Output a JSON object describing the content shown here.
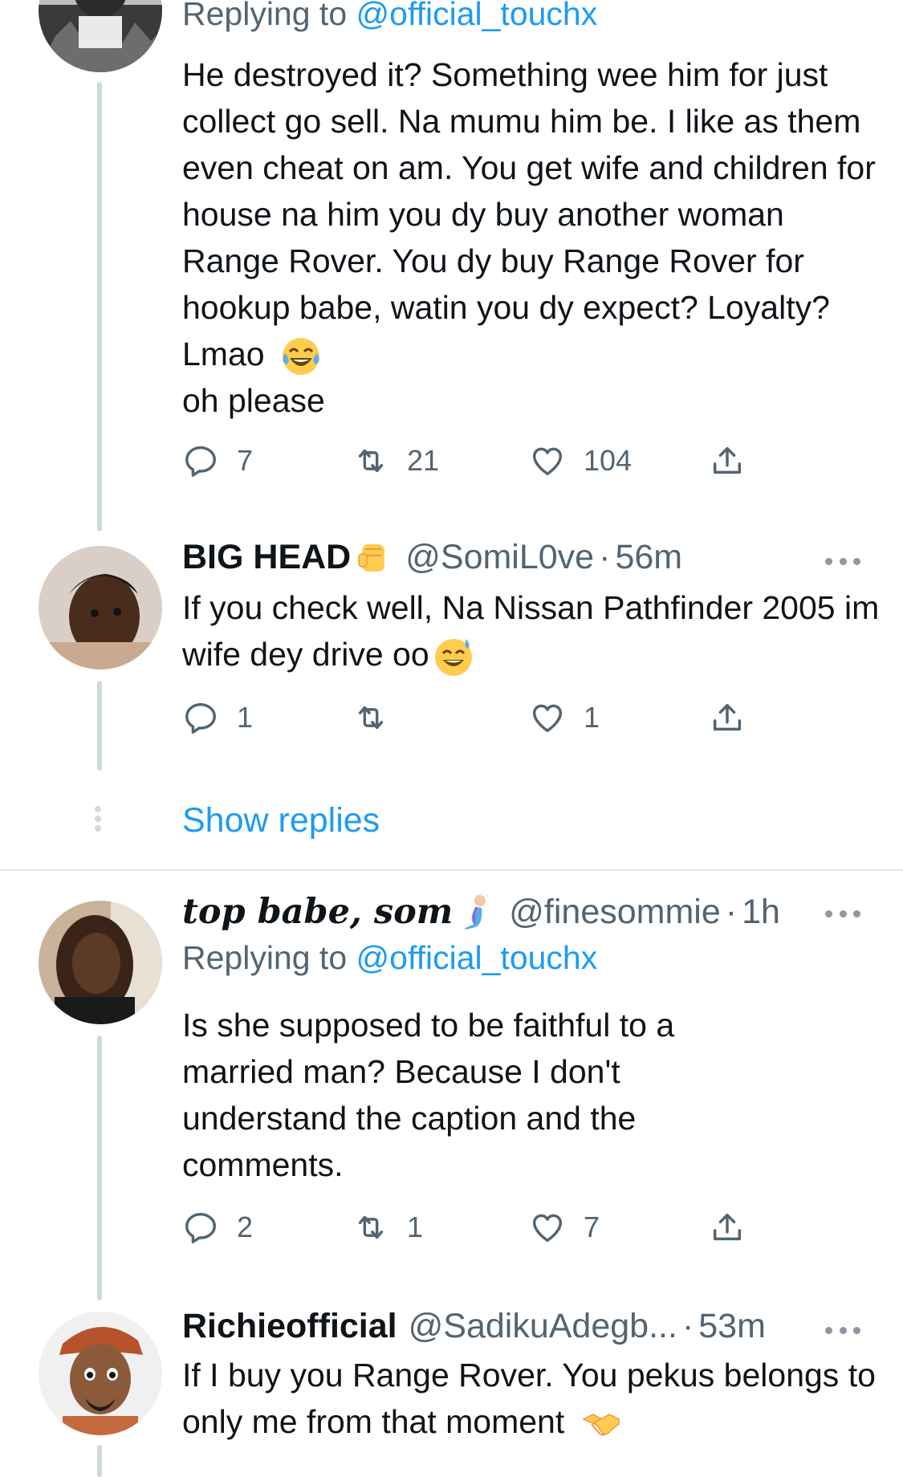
{
  "tweet1": {
    "reply_prefix": "Replying to",
    "reply_handle": "@official_touchx",
    "text": "He destroyed it? Something wee him for just collect go sell. Na mumu him be. I like as them even cheat on am. You get wife and children for house na him you dy buy another woman Range Rover. You dy buy Range Rover for hookup babe, watin you dy expect? Loyalty? Lmao",
    "text_tail": "oh please",
    "emoji": "joy-emoji",
    "replies": "7",
    "retweets": "21",
    "likes": "104"
  },
  "tweet2": {
    "name": "BIG HEAD",
    "name_emoji": "raised-fist-emoji",
    "handle": "@SomiL0ve",
    "dot": "·",
    "time": "56m",
    "text": "If you check well, Na Nissan Pathfinder 2005  im wife dey drive oo",
    "emoji": "sweat-smile-emoji",
    "replies": "1",
    "retweets": "",
    "likes": "1"
  },
  "show_replies": "Show replies",
  "tweet3": {
    "name": "top babe, som",
    "name_emoji": "mermaid-emoji",
    "handle": "@finesommie",
    "dot": "·",
    "time": "1h",
    "reply_prefix": "Replying to",
    "reply_handle": "@official_touchx",
    "text": "Is she supposed to be faithful to a married man? Because I don't understand the caption and the comments.",
    "replies": "2",
    "retweets": "1",
    "likes": "7"
  },
  "tweet4": {
    "name": "Richieofficial",
    "handle": "@SadikuAdegb...",
    "dot": "·",
    "time": "53m",
    "text": "If I buy you Range Rover. You pekus belongs to only me from that moment",
    "emoji": "handshake-emoji"
  },
  "colors": {
    "link": "#1d9bf0",
    "secondary_text": "#536471",
    "thread_line": "#cfd9de"
  }
}
